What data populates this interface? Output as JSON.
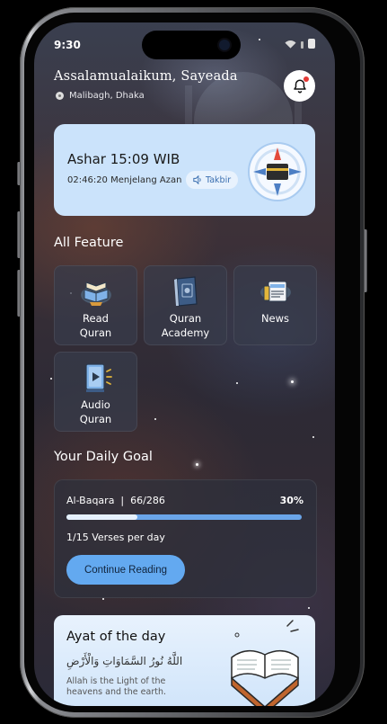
{
  "status_bar": {
    "time": "9:30"
  },
  "header": {
    "greeting": "Assalamualaikum, Sayeada",
    "location": "Malibagh, Dhaka",
    "notification_icon": "bell-icon"
  },
  "prayer_card": {
    "title": "Ashar 15:09 WIB",
    "countdown": "02:46:20 Menjelang Azan",
    "takbir_label": "Takbir",
    "icon": "kaaba-compass-icon"
  },
  "features": {
    "title": "All Feature",
    "items": [
      {
        "line1": "Read",
        "line2": "Quran",
        "icon": "read-quran-icon"
      },
      {
        "line1": "Quran",
        "line2": "Academy",
        "icon": "quran-academy-icon"
      },
      {
        "line1": "News",
        "line2": "",
        "icon": "news-icon"
      },
      {
        "line1": "Audio",
        "line2": "Quran",
        "icon": "audio-quran-icon"
      }
    ]
  },
  "daily_goal": {
    "title": "Your Daily Goal",
    "surah": "Al-Baqara",
    "progress_text": "66/286",
    "percent_label": "30%",
    "progress_fraction": 0.3,
    "verses_per_day": "1/15 Verses per day",
    "button_label": "Continue Reading"
  },
  "ayat": {
    "title": "Ayat of the day",
    "arabic": "اللَّهُ نُورُ السَّمَاوَاتِ وَالْأَرْضِ",
    "translation": "Allah is the Light of the heavens and the earth."
  },
  "colors": {
    "accent": "#63a9f0",
    "card_bg": "#cbe3fb",
    "notification_dot": "#e53935"
  }
}
